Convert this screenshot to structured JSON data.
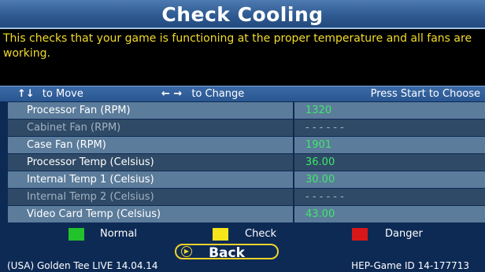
{
  "screen": {
    "title": "Check Cooling",
    "description": "This checks that your game is functioning at the proper temperature and all fans are working."
  },
  "controls": {
    "move_icon": "↑↓",
    "move_label": "to Move",
    "change_icon": "← →",
    "change_label": "to Change",
    "start_label": "Press Start to Choose"
  },
  "rows": [
    {
      "label": "Processor Fan (RPM)",
      "value": "1320",
      "enabled": true
    },
    {
      "label": "Cabinet Fan (RPM)",
      "value": "- - - - - -",
      "enabled": false
    },
    {
      "label": "Case Fan (RPM)",
      "value": "1901",
      "enabled": true
    },
    {
      "label": "Processor Temp (Celsius)",
      "value": "36.00",
      "enabled": true
    },
    {
      "label": "Internal Temp 1 (Celsius)",
      "value": "30.00",
      "enabled": true
    },
    {
      "label": "Internal Temp 2 (Celsius)",
      "value": "- - - - - -",
      "enabled": false
    },
    {
      "label": "Video Card Temp (Celsius)",
      "value": "43.00",
      "enabled": true
    }
  ],
  "legend": [
    {
      "label": "Normal",
      "color": "#22c22a"
    },
    {
      "label": "Check",
      "color": "#f5e51a"
    },
    {
      "label": "Danger",
      "color": "#d81818"
    }
  ],
  "back_button": {
    "label": "Back",
    "icon": "arrow-right-icon"
  },
  "footer": {
    "version": "(USA) Golden Tee LIVE 14.04.14",
    "game_id": "HEP-Game ID 14-177713"
  }
}
